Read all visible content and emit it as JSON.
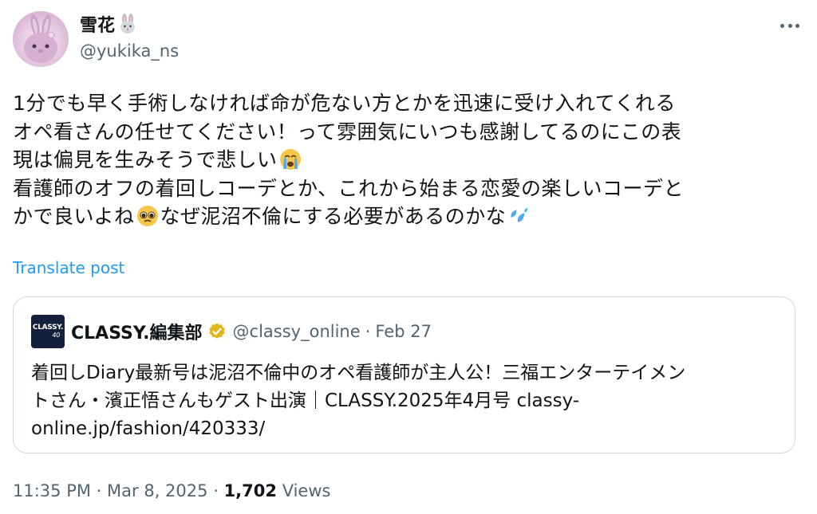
{
  "author": {
    "display_name": "雪花",
    "name_emoji": "rabbit-face",
    "handle": "@yukika_ns"
  },
  "tweet": {
    "lines": [
      "1分でも早く手術しなければ命が危ない方とかを迅速に受け入れてくれる",
      "オペ看さんの任せてください！って雰囲気にいつも感謝してるのにこの表",
      "現は偏見を生みそうで悲しい",
      "看護師のオフの着回しコーデとか、これから始まる恋愛の楽しいコーデと",
      "かで良いよね",
      "なぜ泥沼不倫にする必要があるのかな"
    ],
    "emojis": [
      "loudly-crying-face",
      "pleading-face",
      "sweat-droplets"
    ]
  },
  "translate_label": "Translate post",
  "quote": {
    "logo_text": "CLASSY.",
    "logo_number": "40",
    "name": "CLASSY.編集部",
    "verified": "gold-verified",
    "handle": "@classy_online",
    "separator": "·",
    "date": "Feb 27",
    "lines": [
      "着回しDiary最新号は泥沼不倫中のオペ看護師が主人公！三福エンターテイメン",
      "トさん・濱正悟さんもゲスト出演｜CLASSY.2025年4月号 classy-",
      "online.jp/fashion/420333/"
    ]
  },
  "footer": {
    "time": "11:35 PM",
    "sep1": "·",
    "date": "Mar 8, 2025",
    "sep2": "·",
    "views_count": "1,702",
    "views_label": "Views"
  },
  "colors": {
    "text": "#0f1419",
    "secondary": "#536471",
    "link": "#1d9bf0",
    "border": "#cfd9de",
    "verified_gold": "#e2b719"
  }
}
